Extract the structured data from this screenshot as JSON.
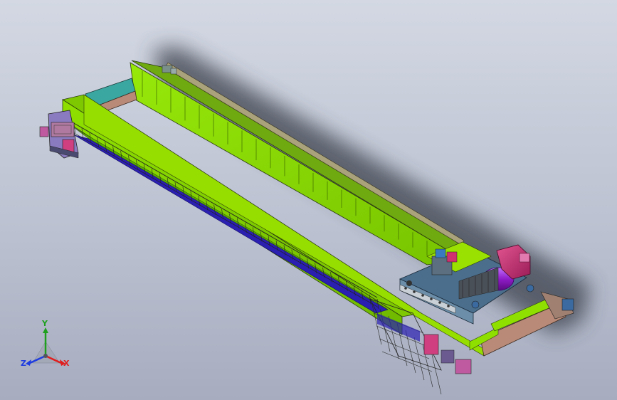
{
  "viewport": {
    "model_name": "overhead-crane-assembly",
    "colors": {
      "girder": "#8fe000",
      "girder_dark": "#4f8a00",
      "end_beam": "#b98a78",
      "walkway": "#2a1fb0",
      "trolley_frame": "#4a6e8c",
      "motor": "#d0307c",
      "drum": "#8f1cc8",
      "crossbeam_teal": "#3aa7a0"
    }
  },
  "triad": {
    "y_label": "Y",
    "x_label": "X",
    "z_label": "Z",
    "colors": {
      "x": "#e01e1e",
      "y": "#1ea01e",
      "z": "#1e3ce0"
    }
  }
}
